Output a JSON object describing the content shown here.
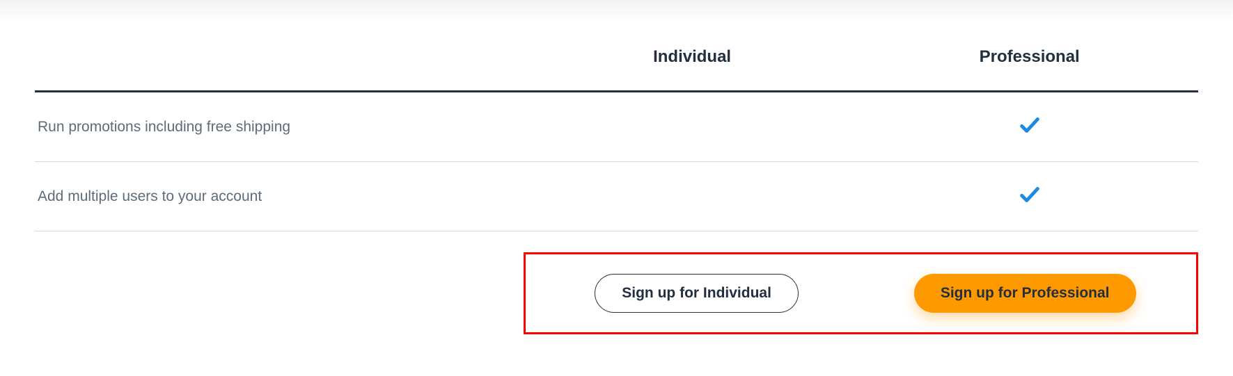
{
  "columns": {
    "individual": "Individual",
    "professional": "Professional"
  },
  "rows": [
    {
      "feature": "Run promotions including free shipping",
      "individual": false,
      "professional": true
    },
    {
      "feature": "Add multiple users to your account",
      "individual": false,
      "professional": true
    }
  ],
  "cta": {
    "individual": "Sign up for Individual",
    "professional": "Sign up for Professional"
  },
  "icons": {
    "check": "check-icon"
  }
}
